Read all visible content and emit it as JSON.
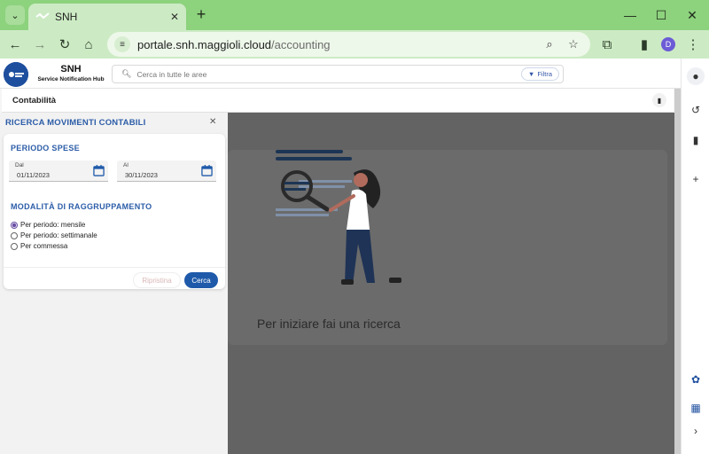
{
  "browser": {
    "tab_title": "SNH",
    "url_host": "portale.snh.maggioli.cloud",
    "url_path": "/accounting",
    "profile_initial": "D",
    "theme_color": "#8dd27d"
  },
  "app": {
    "brand_name": "SNH",
    "brand_subtitle": "Service Notification Hub",
    "search_placeholder": "Cerca in tutte le aree",
    "filter_label": "Filtra"
  },
  "page": {
    "title": "Contabilità"
  },
  "drawer": {
    "title": "RICERCA MOVIMENTI CONTABILI",
    "close_icon": "close-icon",
    "section_period": "PERIODO SPESE",
    "from_label": "Dal",
    "from_value": "01/11/2023",
    "to_label": "Al",
    "to_value": "30/11/2023",
    "section_grouping": "MODALITÀ DI RAGGRUPPAMENTO",
    "grouping_options": [
      {
        "label": "Per periodo: mensile",
        "checked": true
      },
      {
        "label": "Per periodo: settimanale",
        "checked": false
      },
      {
        "label": "Per commessa",
        "checked": false
      }
    ],
    "reset_label": "Ripristina",
    "search_label": "Cerca",
    "accent_color": "#1f5aaa"
  },
  "empty_state": {
    "message": "Per iniziare fai una ricerca"
  }
}
